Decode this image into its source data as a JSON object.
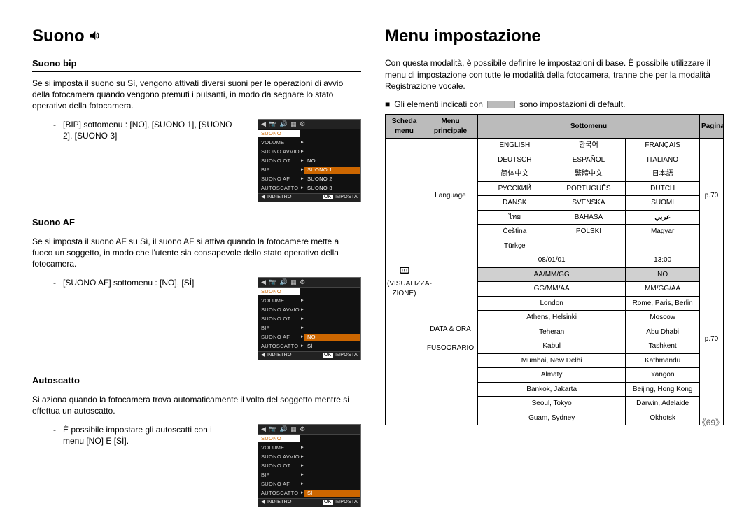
{
  "left": {
    "title_text": "Suono",
    "s1": {
      "h": "Suono bip",
      "p": "Se si imposta il suono su Sì, vengono attivati diversi suoni per le operazioni di avvio della fotocamera quando vengono premuti i pulsanti, in modo da segnare lo stato operativo della fotocamera.",
      "li": "[BIP] sottomenu : [NO], [SUONO 1], [SUONO 2], [SUONO 3]"
    },
    "s2": {
      "h": "Suono AF",
      "p": "Se si imposta il suono AF su Sì, il suono AF si attiva quando la fotocamere mette a fuoco un soggetto, in modo che l'utente sia consapevole dello stato operativo della fotocamera.",
      "li": "[SUONO AF] sottomenu : [NO], [SÌ]"
    },
    "s3": {
      "h": "Autoscatto",
      "p": "Si aziona quando la fotocamera trova automaticamente il volto del soggetto mentre si effettua un autoscatto.",
      "li": "É possibile impostare gli autoscatti con i menu [NO] E [SÌ]."
    },
    "lcd": {
      "items": [
        "SUONO",
        "VOLUME",
        "SUONO AVVIO",
        "SUONO OT.",
        "BIP",
        "SUONO AF",
        "AUTOSCATTO"
      ],
      "vals1": [
        "",
        "",
        "",
        "NO",
        "SUONO 1",
        "SUONO 2",
        "SUONO 3"
      ],
      "vals2": [
        "",
        "",
        "",
        "",
        "",
        "NO",
        "SÌ"
      ],
      "vals3": [
        "",
        "",
        "",
        "",
        "",
        "",
        "SÌ"
      ],
      "back": "INDIETRO",
      "ok": "OK",
      "set": "IMPOSTA"
    }
  },
  "right": {
    "title": "Menu impostazione",
    "intro": "Con questa modalità, è possibile definire le impostazioni di base. È possibile utilizzare il menu di impostazione con tutte le modalità della fotocamera, tranne che per la modalità Registrazione vocale.",
    "note_pre": "Gli elementi indicati con",
    "note_post": "sono impostazioni di default.",
    "headers": {
      "tab": "Scheda menu",
      "main": "Menu principale",
      "sub": "Sottomenu",
      "page": "Pagina"
    },
    "tab_display": "(VISUALIZZA-\nZIONE)",
    "main1": "Language",
    "main2": "DATA & ORA",
    "main2b": "FUSOORARIO",
    "page_ref": "p.70",
    "lang": [
      [
        "ENGLISH",
        "한국어",
        "FRANÇAIS"
      ],
      [
        "DEUTSCH",
        "ESPAÑOL",
        "ITALIANO"
      ],
      [
        "简体中文",
        "繁體中文",
        "日本語"
      ],
      [
        "РУССКИЙ",
        "PORTUGUÊS",
        "DUTCH"
      ],
      [
        "DANSK",
        "SVENSKA",
        "SUOMI"
      ],
      [
        "ไทย",
        "BAHASA",
        "عربي"
      ],
      [
        "Čeština",
        "POLSKI",
        "Magyar"
      ],
      [
        "Türkçe",
        "",
        ""
      ]
    ],
    "dt": {
      "r1": [
        "08/01/01",
        "13:00"
      ],
      "r2_default": [
        "AA/MM/GG",
        "NO"
      ],
      "r3": [
        "GG/MM/AA",
        "MM/GG/AA"
      ]
    },
    "tz": [
      [
        "London",
        "Rome, Paris, Berlin"
      ],
      [
        "Athens, Helsinki",
        "Moscow"
      ],
      [
        "Teheran",
        "Abu Dhabi"
      ],
      [
        "Kabul",
        "Tashkent"
      ],
      [
        "Mumbai, New Delhi",
        "Kathmandu"
      ],
      [
        "Almaty",
        "Yangon"
      ],
      [
        "Bankok, Jakarta",
        "Beijing, Hong Kong"
      ],
      [
        "Seoul, Tokyo",
        "Darwin, Adelaide"
      ],
      [
        "Guam, Sydney",
        "Okhotsk"
      ]
    ]
  },
  "page_no": "《69》"
}
